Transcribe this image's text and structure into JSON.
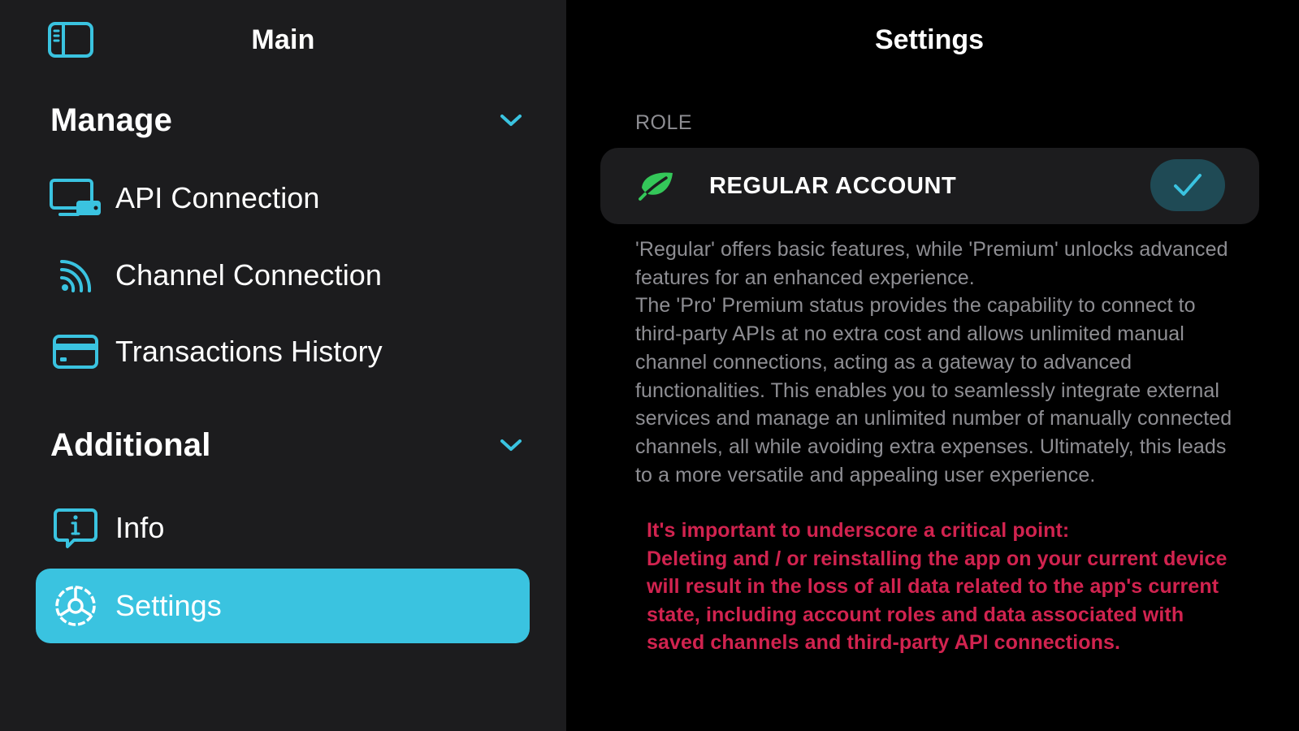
{
  "sidebar": {
    "title": "Main",
    "sections": [
      {
        "title": "Manage",
        "items": [
          {
            "label": "API Connection",
            "icon": "api-connection-icon"
          },
          {
            "label": "Channel Connection",
            "icon": "rss-feed-icon"
          },
          {
            "label": "Transactions History",
            "icon": "credit-card-icon"
          }
        ]
      },
      {
        "title": "Additional",
        "items": [
          {
            "label": "Info",
            "icon": "info-bubble-icon"
          },
          {
            "label": "Settings",
            "icon": "settings-gear-icon",
            "active": true
          }
        ]
      }
    ]
  },
  "content": {
    "title": "Settings",
    "role_section_label": "ROLE",
    "role": {
      "name": "REGULAR ACCOUNT",
      "icon": "leaf-icon",
      "selected": true
    },
    "description": [
      "'Regular' offers basic features, while 'Premium' unlocks advanced features for an enhanced experience.",
      "The 'Pro' Premium status provides the capability to connect to third-party APIs at no extra cost and allows unlimited manual channel connections, acting as a gateway to advanced functionalities. This enables you to seamlessly integrate external services and manage an unlimited number of manually connected channels, all while avoiding extra expenses. Ultimately, this leads to a more versatile and appealing user experience."
    ],
    "warning": [
      "It's important to underscore a critical point:",
      "Deleting and / or reinstalling the app on your current device will result in the loss of all data related to the app's current state, including account roles and data associated with saved channels and third-party API connections."
    ]
  },
  "colors": {
    "accent": "#3ac3e0",
    "sidebar_bg": "#1c1c1e",
    "content_bg": "#000000",
    "card_bg": "#1c1c1e",
    "secondary_text": "#8e8e93",
    "warning_text": "#d1234f",
    "leaf_green": "#34c759",
    "check_bg": "#1f4a55"
  }
}
